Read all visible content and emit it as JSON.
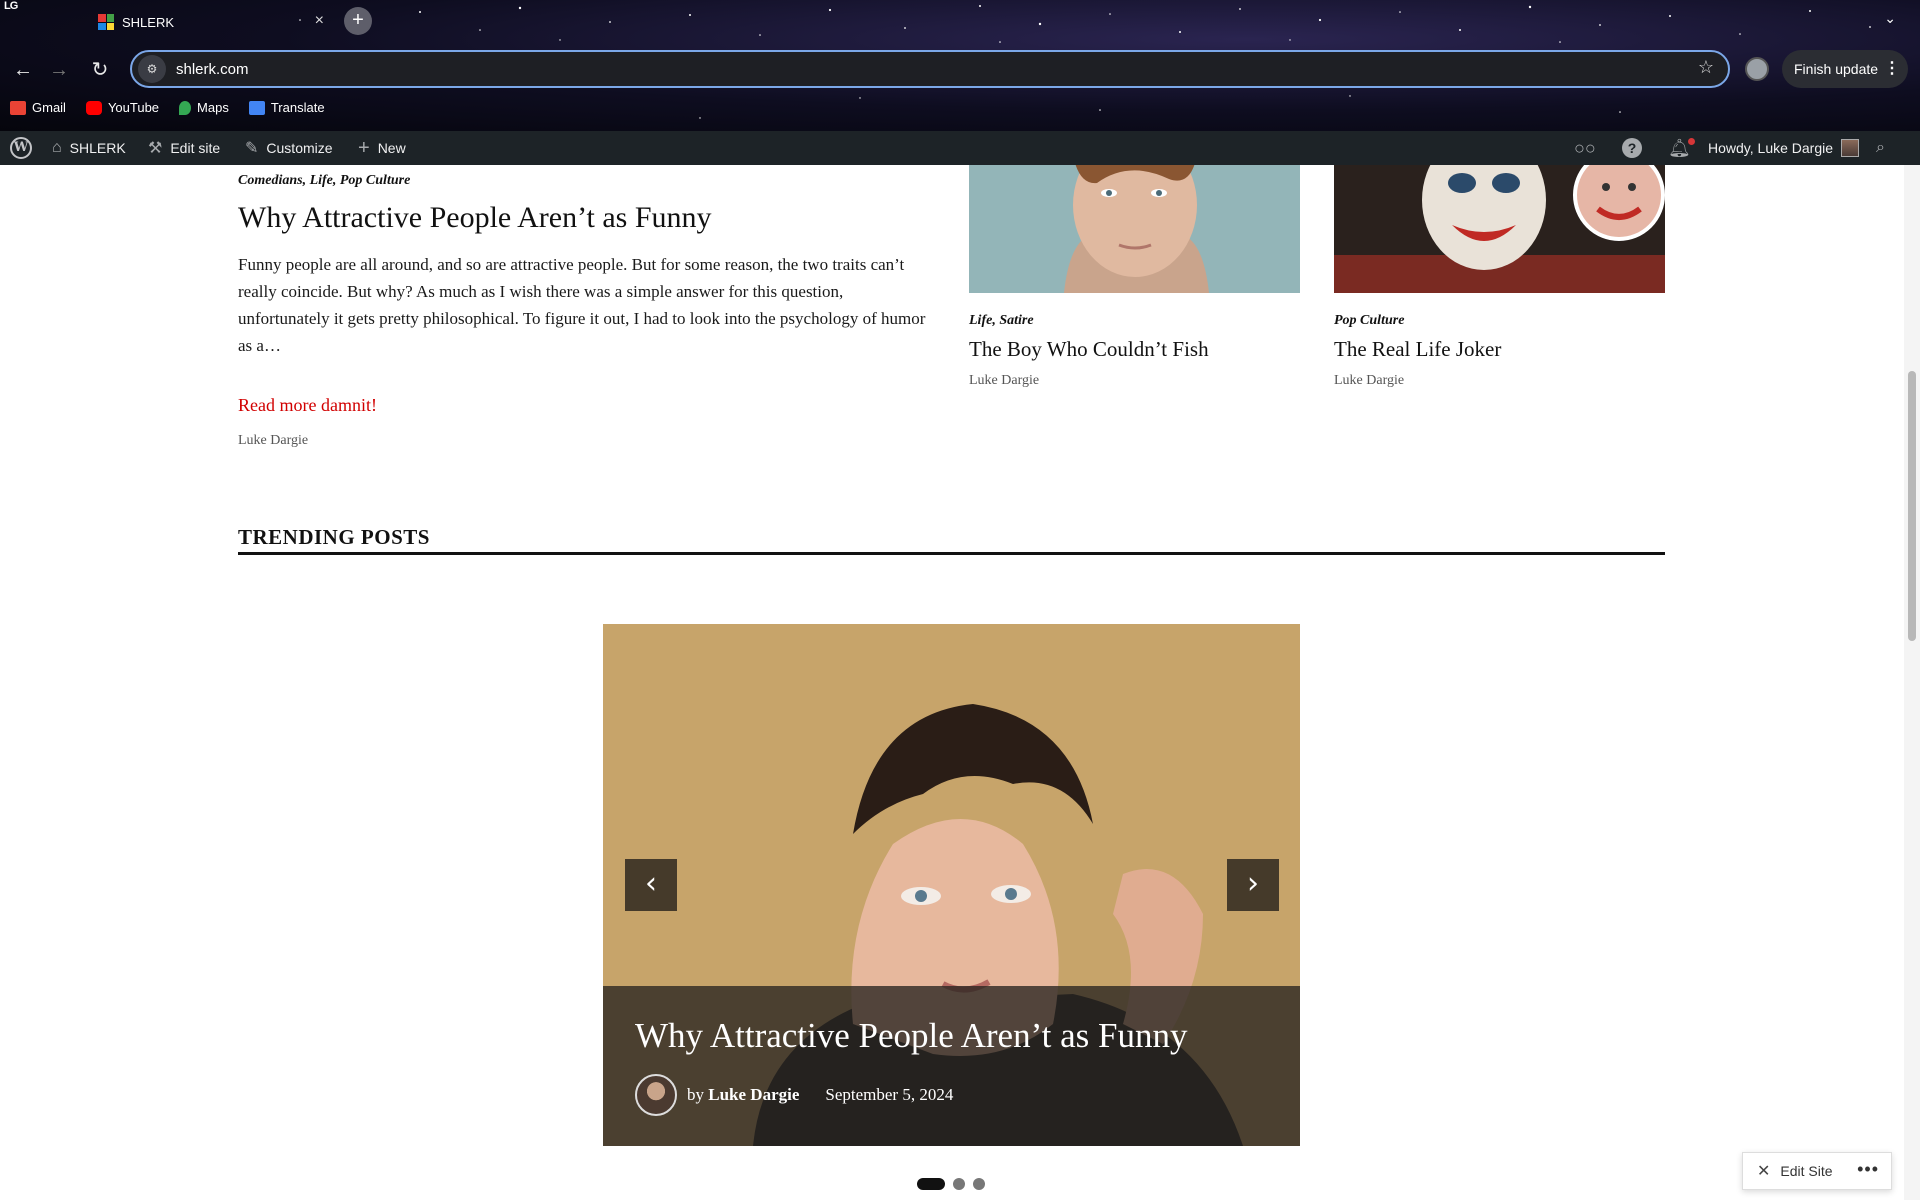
{
  "browser": {
    "logo_text": "LG",
    "tab": {
      "title": "SHLERK",
      "close": "×"
    },
    "new_tab": "+",
    "tab_menu": "⌄",
    "nav": {
      "back": "←",
      "forward": "→",
      "reload": "↻"
    },
    "url": "shlerk.com",
    "bookmark_star": "☆",
    "finish_update": "Finish update",
    "finish_update_menu": "⋮",
    "bookmarks": [
      {
        "label": "Gmail",
        "icon": "gmail-icon",
        "color": "#ea4335"
      },
      {
        "label": "YouTube",
        "icon": "youtube-icon",
        "color": "#ff0000"
      },
      {
        "label": "Maps",
        "icon": "maps-icon",
        "color": "#34a853"
      },
      {
        "label": "Translate",
        "icon": "translate-icon",
        "color": "#4285f4"
      }
    ]
  },
  "adminbar": {
    "site": "SHLERK",
    "edit_site": "Edit site",
    "customize": "Customize",
    "new": "New",
    "howdy": "Howdy, Luke Dargie"
  },
  "featured_post": {
    "categories": "Comedians, Life, Pop Culture",
    "title": "Why Attractive People Aren’t as Funny",
    "excerpt": "Funny people are all around, and so are attractive people. But for some reason, the two traits can’t really coincide. But why? As much as I wish there was a simple answer for this question, unfortunately it gets pretty philosophical. To figure it out, I had to look into the psychology of humor as a…",
    "read_more": "Read more damnit!",
    "author": "Luke Dargie"
  },
  "side_posts": [
    {
      "categories": "Life, Satire",
      "title": "The Boy Who Couldn’t Fish",
      "author": "Luke Dargie"
    },
    {
      "categories": "Pop Culture",
      "title": "The Real Life Joker",
      "author": "Luke Dargie"
    }
  ],
  "trending": {
    "heading": "TRENDING POSTS",
    "slide": {
      "title": "Why Attractive People Aren’t as Funny",
      "by": "by",
      "author": "Luke Dargie",
      "date": "September 5, 2024"
    },
    "prev": "‹",
    "next": "›",
    "slide_count": 3,
    "active_slide": 1
  },
  "floating": {
    "edit_site": "Edit Site",
    "more": "•••"
  },
  "colors": {
    "accent_link": "#d10000",
    "adminbar_bg": "#1d2327",
    "omnibox_border": "#7ba7e8"
  }
}
